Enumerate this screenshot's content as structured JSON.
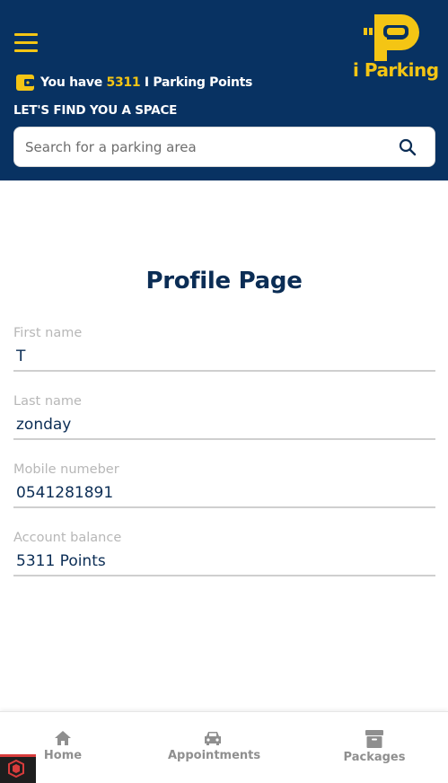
{
  "header": {
    "logo_text": "i Parking",
    "points_prefix": "You have ",
    "points_value": "5311",
    "points_suffix": " I Parking Points",
    "find_title": "LET'S FIND YOU A SPACE",
    "search_placeholder": "Search for a parking area"
  },
  "profile": {
    "title": "Profile Page",
    "fields": [
      {
        "label": "First name",
        "value": "T"
      },
      {
        "label": "Last name",
        "value": "zonday"
      },
      {
        "label": "Mobile numeber",
        "value": "0541281891"
      },
      {
        "label": "Account balance",
        "value": "5311 Points"
      }
    ]
  },
  "bottom_nav": {
    "items": [
      {
        "label": "Home",
        "icon": "home-icon"
      },
      {
        "label": "Appointments",
        "icon": "car-icon"
      },
      {
        "label": "Packages",
        "icon": "archive-box-icon"
      }
    ]
  },
  "colors": {
    "header_bg": "#083262",
    "accent_yellow": "#f4c514",
    "title_navy": "#0b2d55",
    "nav_gray": "#8f8f8f"
  }
}
